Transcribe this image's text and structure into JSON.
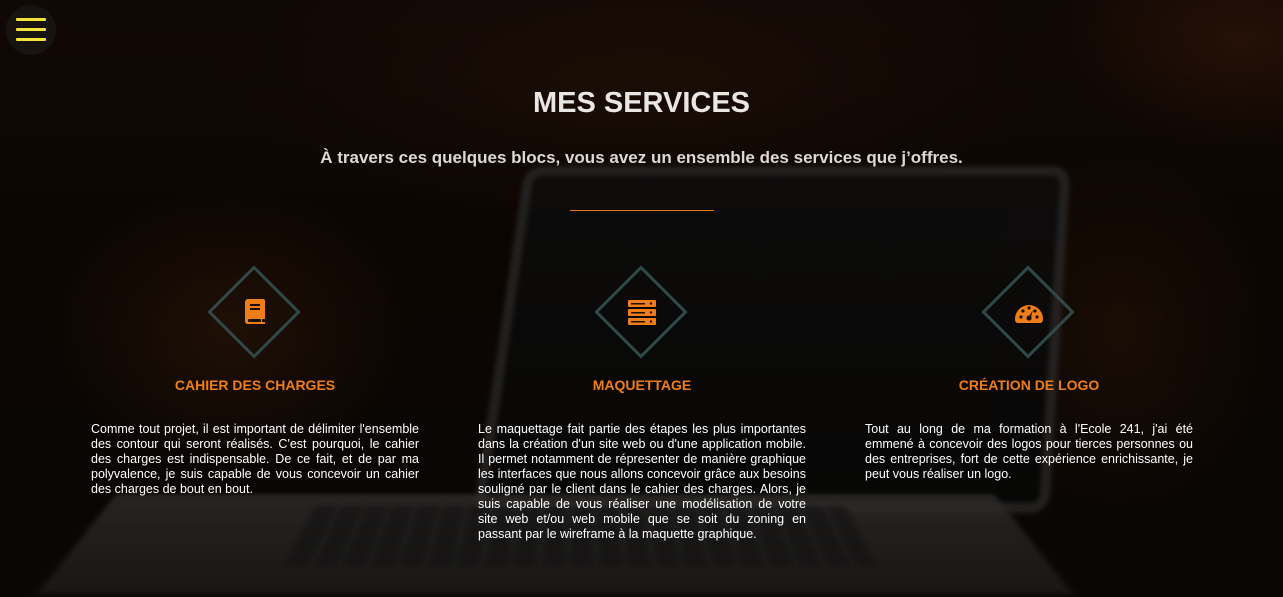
{
  "menu": {
    "icon": "hamburger-menu-icon",
    "accent_color": "#f2e23a"
  },
  "header": {
    "title": "MES SERVICES",
    "subtitle": "À travers ces quelques blocs, vous avez un ensemble des services que j’offres."
  },
  "accent_color": "#f07d18",
  "services": [
    {
      "icon": "book-icon",
      "title": "CAHIER DES CHARGES",
      "text": "Comme tout projet, il est important de délimiter l'ensemble des contour qui seront réalisés. C'est pourquoi, le cahier des charges est indispensable. De ce fait, et de par ma polyvalence, je suis capable de vous concevoir un cahier des charges de bout en bout."
    },
    {
      "icon": "server-icon",
      "title": "MAQUETTAGE",
      "text": "Le maquettage fait partie des étapes les plus importantes dans la création d'un site web ou d'une application mobile. Il permet notamment de répresenter de manière graphique les interfaces que nous allons concevoir grâce aux besoins souligné par le client dans le cahier des charges. Alors, je suis capable de vous réaliser une modélisation de votre site web et/ou web mobile que se soit du zoning en passant par le wireframe à la maquette graphique."
    },
    {
      "icon": "dashboard-gauge-icon",
      "title": "CRÉATION DE LOGO",
      "text": "Tout au long de ma formation à l'Ecole 241, j'ai été emmené à concevoir des logos pour tierces personnes ou des entreprises, fort de cette expérience enrichissante, je peut vous réaliser un logo."
    }
  ]
}
